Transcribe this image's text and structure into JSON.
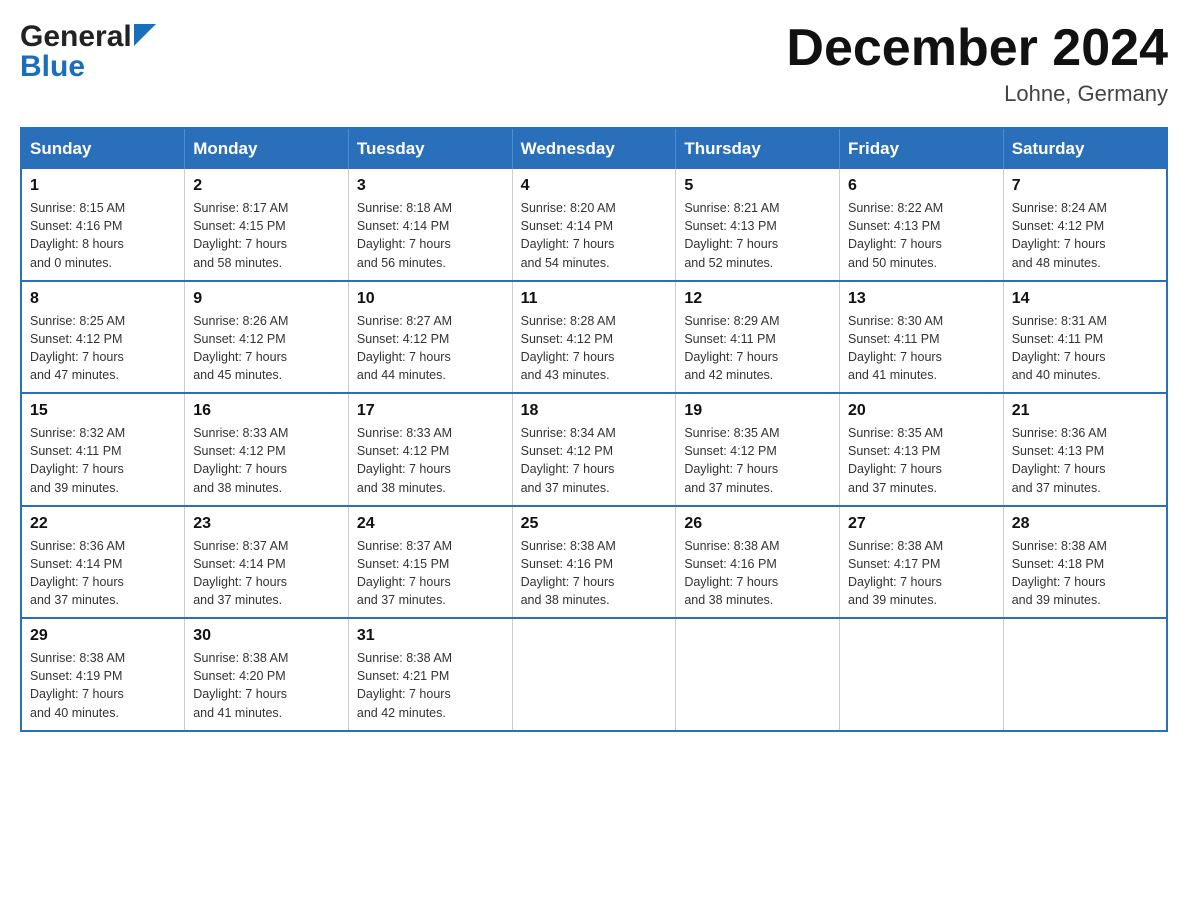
{
  "header": {
    "logo_general": "General",
    "logo_blue": "Blue",
    "month_title": "December 2024",
    "location": "Lohne, Germany"
  },
  "days_of_week": [
    "Sunday",
    "Monday",
    "Tuesday",
    "Wednesday",
    "Thursday",
    "Friday",
    "Saturday"
  ],
  "weeks": [
    [
      {
        "day": "1",
        "sunrise": "8:15 AM",
        "sunset": "4:16 PM",
        "daylight": "8 hours and 0 minutes."
      },
      {
        "day": "2",
        "sunrise": "8:17 AM",
        "sunset": "4:15 PM",
        "daylight": "7 hours and 58 minutes."
      },
      {
        "day": "3",
        "sunrise": "8:18 AM",
        "sunset": "4:14 PM",
        "daylight": "7 hours and 56 minutes."
      },
      {
        "day": "4",
        "sunrise": "8:20 AM",
        "sunset": "4:14 PM",
        "daylight": "7 hours and 54 minutes."
      },
      {
        "day": "5",
        "sunrise": "8:21 AM",
        "sunset": "4:13 PM",
        "daylight": "7 hours and 52 minutes."
      },
      {
        "day": "6",
        "sunrise": "8:22 AM",
        "sunset": "4:13 PM",
        "daylight": "7 hours and 50 minutes."
      },
      {
        "day": "7",
        "sunrise": "8:24 AM",
        "sunset": "4:12 PM",
        "daylight": "7 hours and 48 minutes."
      }
    ],
    [
      {
        "day": "8",
        "sunrise": "8:25 AM",
        "sunset": "4:12 PM",
        "daylight": "7 hours and 47 minutes."
      },
      {
        "day": "9",
        "sunrise": "8:26 AM",
        "sunset": "4:12 PM",
        "daylight": "7 hours and 45 minutes."
      },
      {
        "day": "10",
        "sunrise": "8:27 AM",
        "sunset": "4:12 PM",
        "daylight": "7 hours and 44 minutes."
      },
      {
        "day": "11",
        "sunrise": "8:28 AM",
        "sunset": "4:12 PM",
        "daylight": "7 hours and 43 minutes."
      },
      {
        "day": "12",
        "sunrise": "8:29 AM",
        "sunset": "4:11 PM",
        "daylight": "7 hours and 42 minutes."
      },
      {
        "day": "13",
        "sunrise": "8:30 AM",
        "sunset": "4:11 PM",
        "daylight": "7 hours and 41 minutes."
      },
      {
        "day": "14",
        "sunrise": "8:31 AM",
        "sunset": "4:11 PM",
        "daylight": "7 hours and 40 minutes."
      }
    ],
    [
      {
        "day": "15",
        "sunrise": "8:32 AM",
        "sunset": "4:11 PM",
        "daylight": "7 hours and 39 minutes."
      },
      {
        "day": "16",
        "sunrise": "8:33 AM",
        "sunset": "4:12 PM",
        "daylight": "7 hours and 38 minutes."
      },
      {
        "day": "17",
        "sunrise": "8:33 AM",
        "sunset": "4:12 PM",
        "daylight": "7 hours and 38 minutes."
      },
      {
        "day": "18",
        "sunrise": "8:34 AM",
        "sunset": "4:12 PM",
        "daylight": "7 hours and 37 minutes."
      },
      {
        "day": "19",
        "sunrise": "8:35 AM",
        "sunset": "4:12 PM",
        "daylight": "7 hours and 37 minutes."
      },
      {
        "day": "20",
        "sunrise": "8:35 AM",
        "sunset": "4:13 PM",
        "daylight": "7 hours and 37 minutes."
      },
      {
        "day": "21",
        "sunrise": "8:36 AM",
        "sunset": "4:13 PM",
        "daylight": "7 hours and 37 minutes."
      }
    ],
    [
      {
        "day": "22",
        "sunrise": "8:36 AM",
        "sunset": "4:14 PM",
        "daylight": "7 hours and 37 minutes."
      },
      {
        "day": "23",
        "sunrise": "8:37 AM",
        "sunset": "4:14 PM",
        "daylight": "7 hours and 37 minutes."
      },
      {
        "day": "24",
        "sunrise": "8:37 AM",
        "sunset": "4:15 PM",
        "daylight": "7 hours and 37 minutes."
      },
      {
        "day": "25",
        "sunrise": "8:38 AM",
        "sunset": "4:16 PM",
        "daylight": "7 hours and 38 minutes."
      },
      {
        "day": "26",
        "sunrise": "8:38 AM",
        "sunset": "4:16 PM",
        "daylight": "7 hours and 38 minutes."
      },
      {
        "day": "27",
        "sunrise": "8:38 AM",
        "sunset": "4:17 PM",
        "daylight": "7 hours and 39 minutes."
      },
      {
        "day": "28",
        "sunrise": "8:38 AM",
        "sunset": "4:18 PM",
        "daylight": "7 hours and 39 minutes."
      }
    ],
    [
      {
        "day": "29",
        "sunrise": "8:38 AM",
        "sunset": "4:19 PM",
        "daylight": "7 hours and 40 minutes."
      },
      {
        "day": "30",
        "sunrise": "8:38 AM",
        "sunset": "4:20 PM",
        "daylight": "7 hours and 41 minutes."
      },
      {
        "day": "31",
        "sunrise": "8:38 AM",
        "sunset": "4:21 PM",
        "daylight": "7 hours and 42 minutes."
      },
      null,
      null,
      null,
      null
    ]
  ],
  "labels": {
    "sunrise_prefix": "Sunrise: ",
    "sunset_prefix": "Sunset: ",
    "daylight_prefix": "Daylight: "
  }
}
